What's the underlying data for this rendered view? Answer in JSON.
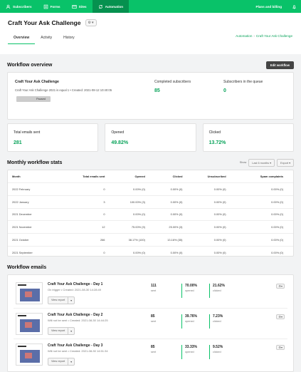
{
  "nav": {
    "items": [
      "Subscribers",
      "Forms",
      "Sites",
      "Automation"
    ],
    "active": "Automation",
    "plans": "Plans and billing"
  },
  "header": {
    "title": "Craft Your Ask Challenge",
    "breadcrumb": [
      "Automation",
      "Craft Your Ask Challenge"
    ],
    "tabs": [
      "Overview",
      "Activity",
      "History"
    ]
  },
  "overview": {
    "section_title": "Workflow overview",
    "edit_btn": "Edit workflow",
    "name": "Craft Your Ask Challenge",
    "detail_name": "Craft Your Ask Challenge 2021",
    "detail_rest": " is equal 1 • Created: 2021-08-12 10:40:05",
    "status": "Paused",
    "completed_label": "Completed subscribers",
    "completed": "85",
    "queue_label": "Subscribers in the queue",
    "queue": "0"
  },
  "stats": [
    {
      "label": "Total emails sent",
      "value": "281"
    },
    {
      "label": "Opened",
      "value": "49.82%"
    },
    {
      "label": "Clicked",
      "value": "13.72%"
    }
  ],
  "monthly": {
    "title": "Monthly workflow stats",
    "show": "Show",
    "range": "Last 6 months",
    "export": "Export",
    "columns": [
      "Month",
      "Total emails sent",
      "Opened",
      "Clicked",
      "Unsubscribed",
      "Spam complaints"
    ],
    "rows": [
      [
        "2022 February",
        "0",
        "0.00% (0)",
        "0.00% (0)",
        "0.00% (0)",
        "0.00% (0)"
      ],
      [
        "2022 January",
        "3",
        "100.00% (3)",
        "0.00% (0)",
        "0.00% (0)",
        "0.00% (0)"
      ],
      [
        "2021 December",
        "0",
        "0.00% (0)",
        "0.00% (0)",
        "0.00% (0)",
        "0.00% (0)"
      ],
      [
        "2021 November",
        "12",
        "75.00% (9)",
        "25.00% (3)",
        "0.00% (0)",
        "0.00% (0)"
      ],
      [
        "2021 October",
        "266",
        "38.17% (100)",
        "13.16% (35)",
        "0.00% (0)",
        "0.00% (0)"
      ],
      [
        "2021 September",
        "0",
        "0.00% (0)",
        "0.00% (0)",
        "0.00% (0)",
        "0.00% (0)"
      ]
    ]
  },
  "emails": {
    "title": "Workflow emails",
    "view_report": "View report",
    "sent_label": "sent",
    "opened_label": "opened",
    "clicked_label": "clicked",
    "items": [
      {
        "name": "Craft Your Ask Challenge - Day 1",
        "sub": "On trigger • Created: 2021-08-30 14:28:49",
        "sent": "111",
        "opened": "70.00%",
        "clicked": "21.62%"
      },
      {
        "name": "Craft Your Ask Challenge - Day 2",
        "sub": "Will not be sent • Created: 2021-08-30 14:44:25",
        "sent": "85",
        "opened": "39.76%",
        "clicked": "7.23%"
      },
      {
        "name": "Craft Your Ask Challenge - Day 3",
        "sub": "Will not be sent • Created: 2021-08-30 14:51:34",
        "sent": "85",
        "opened": "33.33%",
        "clicked": "9.52%"
      }
    ]
  }
}
